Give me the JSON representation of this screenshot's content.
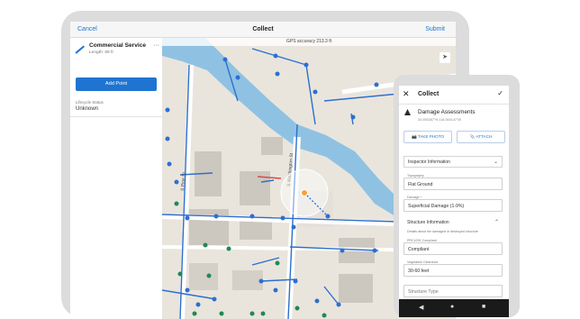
{
  "tablet": {
    "header": {
      "cancel": "Cancel",
      "title": "Collect",
      "submit": "Submit"
    },
    "feature": {
      "name": "Commercial Service",
      "length": "Length: 89 ft",
      "more": "···"
    },
    "add_point_label": "Add Point",
    "lifecycle": {
      "label": "Lifecycle Status",
      "value": "Unknown"
    },
    "map": {
      "gps_text": "GPS accuracy 213.3 ft",
      "street_a": "S Pine St",
      "street_b": "S Washington St"
    }
  },
  "phone": {
    "header": {
      "close": "✕",
      "title": "Collect",
      "done": "✓"
    },
    "record": {
      "name": "Damage Assessments",
      "coords": "34.055367°N 118.364147°W"
    },
    "take_photo": "TAKE PHOTO",
    "attach": "ATTACH",
    "inspector_section": "Inspector Information",
    "topography": {
      "label": "Topography",
      "value": "Flat Ground"
    },
    "damage": {
      "label": "Damage *",
      "value": "Superficial Damage (1-9%)"
    },
    "structure_section": "Structure Information",
    "structure_hint": "Details about the damaged or destroyed structure",
    "pr_compliant": {
      "label": "PRC4291 Compliant",
      "value": "Compliant"
    },
    "veg_clearance": {
      "label": "Vegetation Clearance",
      "value": "30-60 feet"
    },
    "structure_type": "Structure Type"
  },
  "colors": {
    "accent": "#1f74d1",
    "water": "#8fc2e2",
    "pipe": "#2d6fcf"
  }
}
